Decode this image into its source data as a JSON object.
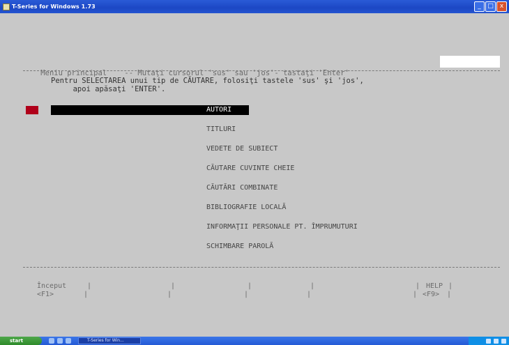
{
  "window": {
    "title": "T-Series for Windows 1.73",
    "buttons": [
      "_",
      "□",
      "x"
    ]
  },
  "header": {
    "text": "Meniu principal    -- Mutaţi cursorul 'sus' sau 'jos'- tastaţi 'Enter'"
  },
  "instructions": {
    "line1": "Pentru SELECTAREA unui tip de CĂUTARE, folosiţi tastele 'sus' şi 'jos',",
    "line2": "     apoi apăsaţi 'ENTER'."
  },
  "cursor_marker": "=>",
  "menu": {
    "items": [
      "AUTORI",
      "TITLURI",
      "VEDETE DE SUBIECT",
      "CĂUTARE CUVINTE CHEIE",
      "CĂUTĂRI COMBINATE",
      "BIBLIOGRAFIE LOCALĂ",
      "INFORMAŢII PERSONALE PT. ÎMPRUMUTURI",
      "SCHIMBARE PAROLĂ"
    ],
    "selected_index": 0
  },
  "function_keys": {
    "inceput_label": "Început",
    "inceput_key": "<F1>",
    "help_label": "HELP",
    "help_key": "<F9>"
  },
  "taskbar": {
    "start_label": "start",
    "task_label": "T-Series for Win..."
  }
}
